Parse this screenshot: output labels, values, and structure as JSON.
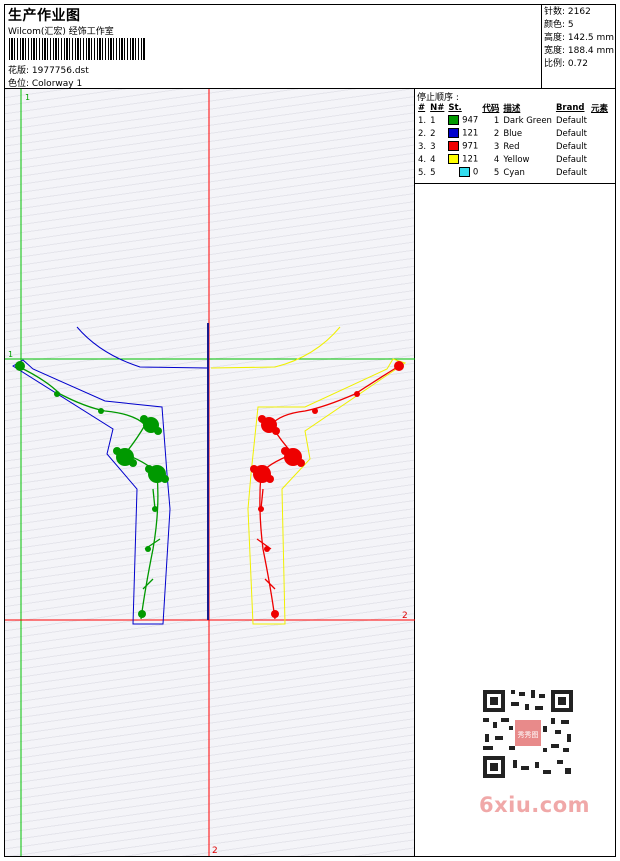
{
  "header": {
    "title": "生产作业图",
    "company": "Wilcom(汇宏) 经饰工作室",
    "design_label": "花版: 1977756.dst",
    "colorway_label": "色位: Colorway 1"
  },
  "stats": {
    "stitches": "针数: 2162",
    "colors": "颜色: 5",
    "height": "高度: 142.5 mm",
    "width": "宽度: 188.4 mm",
    "scale": "比例: 0.72"
  },
  "canvas": {
    "marker_1_top": "1",
    "marker_1_left": "1",
    "marker_2_right": "2",
    "marker_2_bottom": "2",
    "colors": {
      "green": "#00c000",
      "red": "#ff0000",
      "blue": "#0000c0",
      "yellow": "#ffff00",
      "navy": "#1a1a8c",
      "thread_green": "#009900",
      "thread_red": "#ee0000",
      "outline_blue": "#0000cc",
      "outline_yellow": "#f0f000"
    }
  },
  "stop_sequence": {
    "title": "停止顺序 :",
    "headers": [
      "#",
      "N#",
      "St.",
      "代码",
      "描述",
      "Brand",
      "元素"
    ],
    "rows": [
      {
        "idx": "1.",
        "n": "1",
        "color": "#009900",
        "st": "947",
        "code": "1",
        "desc": "Dark Green",
        "brand": "Default"
      },
      {
        "idx": "2.",
        "n": "2",
        "color": "#0000cc",
        "st": "121",
        "code": "2",
        "desc": "Blue",
        "brand": "Default"
      },
      {
        "idx": "3.",
        "n": "3",
        "color": "#ee0000",
        "st": "971",
        "code": "3",
        "desc": "Red",
        "brand": "Default"
      },
      {
        "idx": "4.",
        "n": "4",
        "color": "#ffff00",
        "st": "121",
        "code": "4",
        "desc": "Yellow",
        "brand": "Default"
      },
      {
        "idx": "5.",
        "n": "5",
        "color": "#33ddee",
        "st": "0",
        "code": "5",
        "desc": "Cyan",
        "brand": "Default"
      }
    ]
  },
  "watermark": {
    "text": "6xiu.com",
    "qr_stamp": "秀秀图"
  }
}
